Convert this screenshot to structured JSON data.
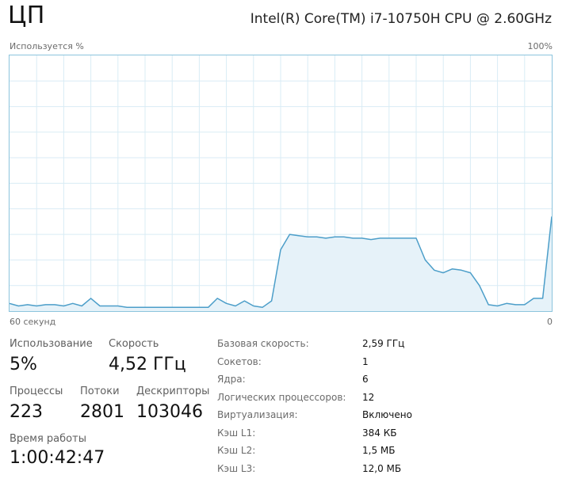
{
  "header": {
    "title": "ЦП",
    "cpu_model": "Intel(R) Core(TM) i7-10750H CPU @ 2.60GHz"
  },
  "graph": {
    "y_label": "Используется %",
    "y_max_label": "100%",
    "x_left_label": "60 секунд",
    "x_right_label": "0",
    "line_color": "#4c9ec9",
    "fill_color": "#e6f2f9",
    "grid_color": "#d9ecf5"
  },
  "chart_data": {
    "type": "area",
    "ylim": [
      0,
      100
    ],
    "xlim": [
      60,
      0
    ],
    "grid": true,
    "x": [
      60,
      59,
      58,
      57,
      56,
      55,
      54,
      53,
      52,
      51,
      50,
      49,
      48,
      47,
      46,
      45,
      44,
      43,
      42,
      41,
      40,
      39,
      38,
      37,
      36,
      35,
      34,
      33,
      32,
      31,
      30,
      29,
      28,
      27,
      26,
      25,
      24,
      23,
      22,
      21,
      20,
      19,
      18,
      17,
      16,
      15,
      14,
      13,
      12,
      11,
      10,
      9,
      8,
      7,
      6,
      5,
      4,
      3,
      2,
      1,
      0
    ],
    "values": [
      3,
      2,
      2.5,
      2,
      2.5,
      2.5,
      2,
      3,
      2,
      5,
      2,
      2,
      2,
      1.5,
      1.5,
      1.5,
      1.5,
      1.5,
      1.5,
      1.5,
      1.5,
      1.5,
      1.5,
      5,
      3,
      2,
      4,
      2,
      1.5,
      4,
      24,
      30,
      29.5,
      29,
      29,
      28.5,
      29,
      29,
      28.5,
      28.5,
      28,
      28.5,
      28.5,
      28.5,
      28.5,
      28.5,
      20,
      16,
      15,
      16.5,
      16,
      15,
      10,
      2.5,
      2,
      3,
      2.5,
      2.5,
      5,
      5,
      37
    ]
  },
  "stats": {
    "usage_label": "Использование",
    "usage_value": "5%",
    "speed_label": "Скорость",
    "speed_value": "4,52 ГГц",
    "processes_label": "Процессы",
    "processes_value": "223",
    "threads_label": "Потоки",
    "threads_value": "2801",
    "handles_label": "Дескрипторы",
    "handles_value": "103046",
    "uptime_label": "Время работы",
    "uptime_value": "1:00:42:47"
  },
  "info": [
    {
      "label": "Базовая скорость:",
      "value": "2,59 ГГц"
    },
    {
      "label": "Сокетов:",
      "value": "1"
    },
    {
      "label": "Ядра:",
      "value": "6"
    },
    {
      "label": "Логических процессоров:",
      "value": "12"
    },
    {
      "label": "Виртуализация:",
      "value": "Включено"
    },
    {
      "label": "Кэш L1:",
      "value": "384 КБ"
    },
    {
      "label": "Кэш L2:",
      "value": "1,5 МБ"
    },
    {
      "label": "Кэш L3:",
      "value": "12,0 МБ"
    }
  ]
}
